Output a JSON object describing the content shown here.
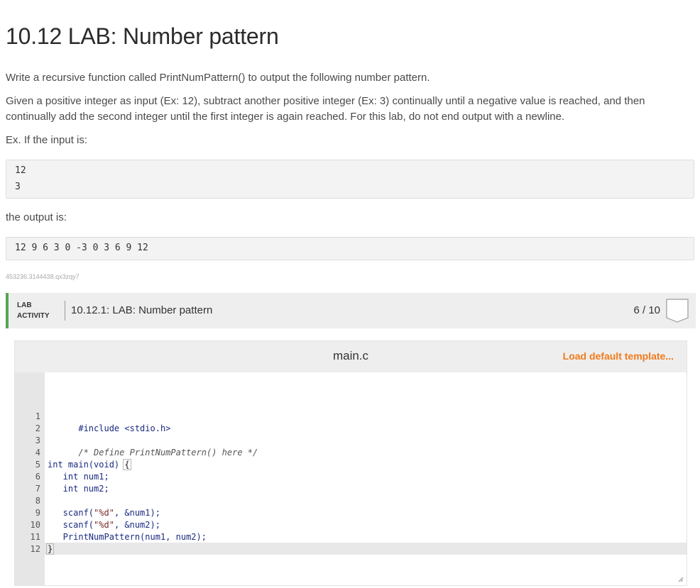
{
  "page": {
    "title": "10.12 LAB: Number pattern",
    "intro": "Write a recursive function called PrintNumPattern() to output the following number pattern.",
    "description": "Given a positive integer as input (Ex: 12), subtract another positive integer (Ex: 3) continually until a negative value is reached, and then continually add the second integer until the first integer is again reached. For this lab, do not end output with a newline.",
    "example_label": "Ex. If the input is:",
    "input_lines": [
      "12",
      "3"
    ],
    "output_label": "the output is:",
    "output_line": "12 9 6 3 0 -3 0 3 6 9 12",
    "caption_id": "453236.3144438.qx3zqy7"
  },
  "lab": {
    "tag_line1": "LAB",
    "tag_line2": "ACTIVITY",
    "title": "10.12.1: LAB: Number pattern",
    "score": "6 / 10",
    "accent_color": "#5aa35a"
  },
  "editor": {
    "file_name": "main.c",
    "load_template_label": "Load default template...",
    "load_template_color": "#f27a1a",
    "line_numbers": [
      "1",
      "2",
      "3",
      "4",
      "5",
      "6",
      "7",
      "8",
      "9",
      "10",
      "11",
      "12"
    ],
    "lines": {
      "l1_pre": "#include <stdio.h>",
      "l3_comment": "/* Define PrintNumPattern() here */",
      "l5_kw": "int",
      "l5_rest": " main(void) ",
      "l5_brace": "{",
      "l6": "   int num1;",
      "l7": "   int num2;",
      "l9_pre": "   scanf(",
      "l9_str": "\"%d\"",
      "l9_post": ", &num1);",
      "l10_pre": "   scanf(",
      "l10_str": "\"%d\"",
      "l10_post": ", &num2);",
      "l11": "   PrintNumPattern(num1, num2);",
      "l12_brace": "}"
    }
  }
}
